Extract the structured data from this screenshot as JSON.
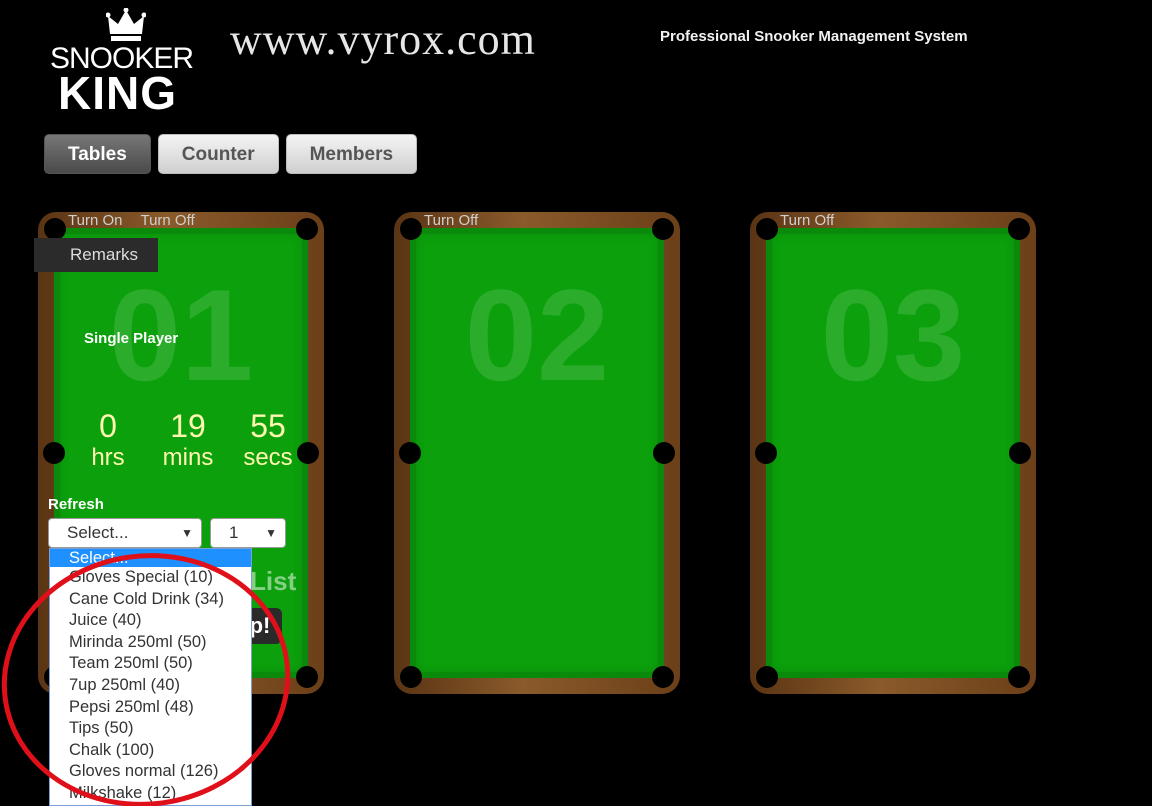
{
  "header": {
    "logo_line1": "SNOOKER",
    "logo_line2": "KING",
    "site_url": "www.vyrox.com",
    "tagline": "Professional Snooker Management System"
  },
  "nav": {
    "tables": "Tables",
    "counter": "Counter",
    "members": "Members"
  },
  "tables": [
    {
      "number": "01",
      "turn_on": "Turn On",
      "turn_off": "Turn Off",
      "remarks": "Remarks",
      "player_type": "Single Player",
      "timer": {
        "hrs": "0",
        "hrs_label": "hrs",
        "mins": "19",
        "mins_label": "mins",
        "secs": "55",
        "secs_label": "secs"
      },
      "refresh": "Refresh",
      "product_select": "Select...",
      "qty_select": "1",
      "behind_text": "List",
      "behind_btn": "p!"
    },
    {
      "number": "02",
      "turn_off": "Turn Off"
    },
    {
      "number": "03",
      "turn_off": "Turn Off"
    }
  ],
  "dropdown": {
    "items": [
      "Select...",
      "Gloves Special (10)",
      "Cane Cold Drink (34)",
      "Juice (40)",
      "Mirinda 250ml (50)",
      "Team 250ml (50)",
      "7up 250ml (40)",
      "Pepsi 250ml (48)",
      "Tips (50)",
      "Chalk (100)",
      "Gloves normal (126)",
      "Milkshake (12)"
    ]
  },
  "colors": {
    "felt": "#0ca00c",
    "wood": "#8a5a2a",
    "annotation": "#e0101a",
    "dropdown_highlight": "#1e90ff"
  }
}
